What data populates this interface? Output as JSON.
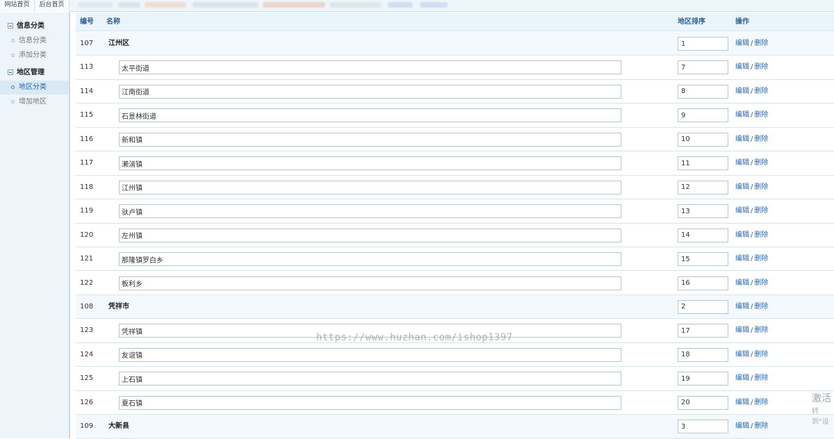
{
  "topbar": {
    "tabs": [
      "网站首页",
      "后台首页"
    ]
  },
  "sidebar": {
    "groups": [
      {
        "label": "信息分类",
        "items": [
          "信息分类",
          "添加分类"
        ]
      },
      {
        "label": "地区管理",
        "items": [
          "地区分类",
          "增加地区"
        ]
      }
    ],
    "active_item": "地区分类"
  },
  "table": {
    "headers": {
      "id": "编号",
      "name": "名称",
      "sort": "地区排序",
      "ops": "操作"
    },
    "edit_label": "编辑",
    "separator": "/",
    "delete_label": "删除",
    "rows": [
      {
        "id": "107",
        "name": "江州区",
        "sort": "1",
        "parent": true
      },
      {
        "id": "113",
        "name": "太平街道",
        "sort": "7",
        "parent": false
      },
      {
        "id": "114",
        "name": "江南街道",
        "sort": "8",
        "parent": false
      },
      {
        "id": "115",
        "name": "石景林街道",
        "sort": "9",
        "parent": false
      },
      {
        "id": "116",
        "name": "新和镇",
        "sort": "10",
        "parent": false
      },
      {
        "id": "117",
        "name": "濑湍镇",
        "sort": "11",
        "parent": false
      },
      {
        "id": "118",
        "name": "江州镇",
        "sort": "12",
        "parent": false
      },
      {
        "id": "119",
        "name": "驮卢镇",
        "sort": "13",
        "parent": false
      },
      {
        "id": "120",
        "name": "左州镇",
        "sort": "14",
        "parent": false
      },
      {
        "id": "121",
        "name": "那隆镇罗白乡",
        "sort": "15",
        "parent": false
      },
      {
        "id": "122",
        "name": "板利乡",
        "sort": "16",
        "parent": false
      },
      {
        "id": "108",
        "name": "凭祥市",
        "sort": "2",
        "parent": true
      },
      {
        "id": "123",
        "name": "凭祥镇",
        "sort": "17",
        "parent": false
      },
      {
        "id": "124",
        "name": "友谊镇",
        "sort": "18",
        "parent": false
      },
      {
        "id": "125",
        "name": "上石镇",
        "sort": "19",
        "parent": false
      },
      {
        "id": "126",
        "name": "夏石镇",
        "sort": "20",
        "parent": false
      },
      {
        "id": "109",
        "name": "大新县",
        "sort": "3",
        "parent": true
      }
    ]
  },
  "watermark": "https://www.huzhan.com/ishop1397",
  "os_overlay": {
    "line1": "激活",
    "line2": "转到\"设"
  }
}
